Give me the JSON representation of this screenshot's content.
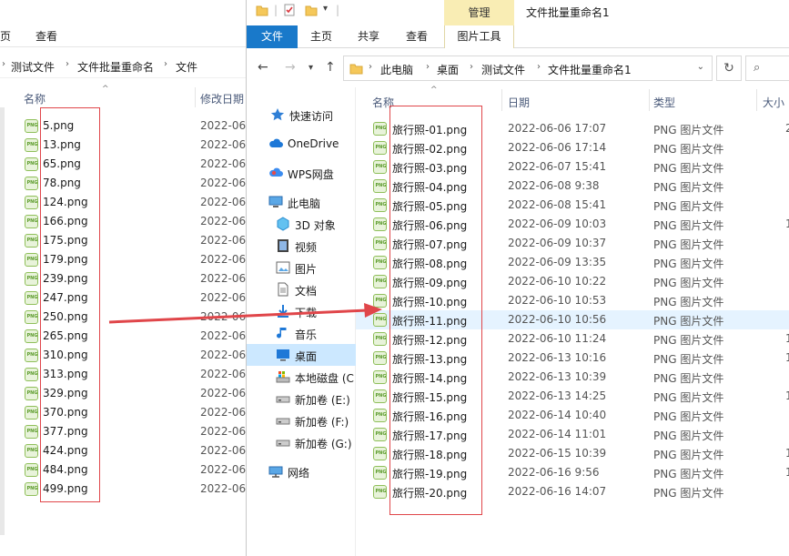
{
  "back_window": {
    "ribbon_tabs": [
      "页",
      "查看"
    ],
    "breadcrumbs": [
      "测试文件",
      "文件批量重命名",
      "文件"
    ],
    "columns": {
      "name": "名称",
      "date": "修改日期"
    },
    "files": [
      {
        "name": "5.png",
        "date": "2022-06-"
      },
      {
        "name": "13.png",
        "date": "2022-06-"
      },
      {
        "name": "65.png",
        "date": "2022-06-"
      },
      {
        "name": "78.png",
        "date": "2022-06-"
      },
      {
        "name": "124.png",
        "date": "2022-06-"
      },
      {
        "name": "166.png",
        "date": "2022-06-"
      },
      {
        "name": "175.png",
        "date": "2022-06-"
      },
      {
        "name": "179.png",
        "date": "2022-06-"
      },
      {
        "name": "239.png",
        "date": "2022-06-"
      },
      {
        "name": "247.png",
        "date": "2022-06-"
      },
      {
        "name": "250.png",
        "date": "2022-06-"
      },
      {
        "name": "265.png",
        "date": "2022-06-"
      },
      {
        "name": "310.png",
        "date": "2022-06-"
      },
      {
        "name": "313.png",
        "date": "2022-06-"
      },
      {
        "name": "329.png",
        "date": "2022-06-"
      },
      {
        "name": "370.png",
        "date": "2022-06-"
      },
      {
        "name": "377.png",
        "date": "2022-06-"
      },
      {
        "name": "424.png",
        "date": "2022-06-"
      },
      {
        "name": "484.png",
        "date": "2022-06-"
      },
      {
        "name": "499.png",
        "date": "2022-06-"
      }
    ]
  },
  "front_window": {
    "title": "文件批量重命名1",
    "contextual_tab": "管理",
    "ribbon_tabs": {
      "file": "文件",
      "home": "主页",
      "share": "共享",
      "view": "查看",
      "picture_tools": "图片工具"
    },
    "breadcrumbs": [
      "此电脑",
      "桌面",
      "测试文件",
      "文件批量重命名1"
    ],
    "nav": [
      {
        "label": "快速访问",
        "icon": "star-icon"
      },
      {
        "label": "OneDrive",
        "icon": "cloud-icon"
      },
      {
        "label": "WPS网盘",
        "icon": "wps-cloud-icon"
      },
      {
        "label": "此电脑",
        "icon": "computer-icon"
      },
      {
        "label": "3D 对象",
        "icon": "cube-icon"
      },
      {
        "label": "视频",
        "icon": "video-icon"
      },
      {
        "label": "图片",
        "icon": "picture-icon"
      },
      {
        "label": "文档",
        "icon": "document-icon"
      },
      {
        "label": "下载",
        "icon": "download-icon"
      },
      {
        "label": "音乐",
        "icon": "music-icon"
      },
      {
        "label": "桌面",
        "icon": "desktop-icon"
      },
      {
        "label": "本地磁盘 (C",
        "icon": "drive-c-icon"
      },
      {
        "label": "新加卷 (E:)",
        "icon": "drive-icon"
      },
      {
        "label": "新加卷 (F:)",
        "icon": "drive-icon"
      },
      {
        "label": "新加卷 (G:)",
        "icon": "drive-icon"
      },
      {
        "label": "网络",
        "icon": "network-icon"
      }
    ],
    "columns": {
      "name": "名称",
      "date": "日期",
      "type": "类型",
      "size": "大小"
    },
    "files": [
      {
        "name": "旅行照-01.png",
        "date": "2022-06-06 17:07",
        "type": "PNG 图片文件",
        "size": "2"
      },
      {
        "name": "旅行照-02.png",
        "date": "2022-06-06 17:14",
        "type": "PNG 图片文件",
        "size": ""
      },
      {
        "name": "旅行照-03.png",
        "date": "2022-06-07 15:41",
        "type": "PNG 图片文件",
        "size": ""
      },
      {
        "name": "旅行照-04.png",
        "date": "2022-06-08 9:38",
        "type": "PNG 图片文件",
        "size": ""
      },
      {
        "name": "旅行照-05.png",
        "date": "2022-06-08 15:41",
        "type": "PNG 图片文件",
        "size": ""
      },
      {
        "name": "旅行照-06.png",
        "date": "2022-06-09 10:03",
        "type": "PNG 图片文件",
        "size": "1"
      },
      {
        "name": "旅行照-07.png",
        "date": "2022-06-09 10:37",
        "type": "PNG 图片文件",
        "size": ""
      },
      {
        "name": "旅行照-08.png",
        "date": "2022-06-09 13:35",
        "type": "PNG 图片文件",
        "size": ""
      },
      {
        "name": "旅行照-09.png",
        "date": "2022-06-10 10:22",
        "type": "PNG 图片文件",
        "size": ""
      },
      {
        "name": "旅行照-10.png",
        "date": "2022-06-10 10:53",
        "type": "PNG 图片文件",
        "size": ""
      },
      {
        "name": "旅行照-11.png",
        "date": "2022-06-10 10:56",
        "type": "PNG 图片文件",
        "size": ""
      },
      {
        "name": "旅行照-12.png",
        "date": "2022-06-10 11:24",
        "type": "PNG 图片文件",
        "size": "1"
      },
      {
        "name": "旅行照-13.png",
        "date": "2022-06-13 10:16",
        "type": "PNG 图片文件",
        "size": "1"
      },
      {
        "name": "旅行照-14.png",
        "date": "2022-06-13 10:39",
        "type": "PNG 图片文件",
        "size": ""
      },
      {
        "name": "旅行照-15.png",
        "date": "2022-06-13 14:25",
        "type": "PNG 图片文件",
        "size": "1"
      },
      {
        "name": "旅行照-16.png",
        "date": "2022-06-14 10:40",
        "type": "PNG 图片文件",
        "size": ""
      },
      {
        "name": "旅行照-17.png",
        "date": "2022-06-14 11:01",
        "type": "PNG 图片文件",
        "size": ""
      },
      {
        "name": "旅行照-18.png",
        "date": "2022-06-15 10:39",
        "type": "PNG 图片文件",
        "size": "1"
      },
      {
        "name": "旅行照-19.png",
        "date": "2022-06-16 9:56",
        "type": "PNG 图片文件",
        "size": "1"
      },
      {
        "name": "旅行照-20.png",
        "date": "2022-06-16 14:07",
        "type": "PNG 图片文件",
        "size": ""
      }
    ]
  },
  "colors": {
    "accent": "#1979ca",
    "annotation": "#e0464a",
    "selection": "#cce8ff",
    "hover_row": "#e5f3ff",
    "manage_tab": "#f9edb4"
  }
}
